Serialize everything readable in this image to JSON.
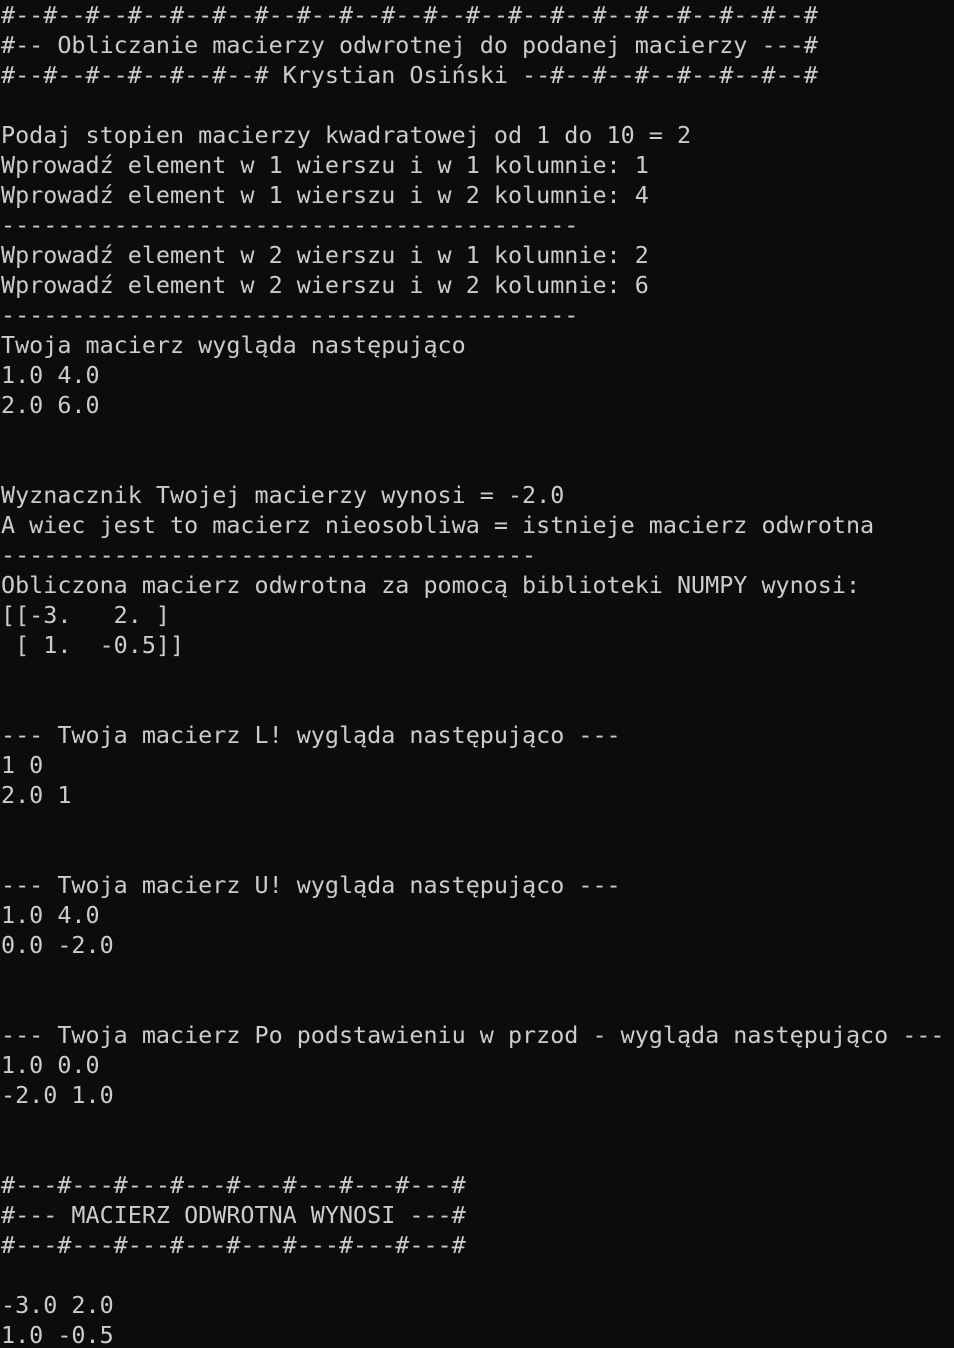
{
  "terminal": {
    "foreground": "#cccccc",
    "background": "#0c0c0c",
    "lines": [
      "#--#--#--#--#--#--#--#--#--#--#--#--#--#--#--#--#--#--#--#",
      "#-- Obliczanie macierzy odwrotnej do podanej macierzy ---#",
      "#--#--#--#--#--#--# Krystian Osiński --#--#--#--#--#--#--#",
      "",
      "Podaj stopien macierzy kwadratowej od 1 do 10 = 2",
      "Wprowadź element w 1 wierszu i w 1 kolumnie: 1",
      "Wprowadź element w 1 wierszu i w 2 kolumnie: 4",
      "-----------------------------------------",
      "Wprowadź element w 2 wierszu i w 1 kolumnie: 2",
      "Wprowadź element w 2 wierszu i w 2 kolumnie: 6",
      "-----------------------------------------",
      "Twoja macierz wygląda następująco",
      "1.0 4.0",
      "2.0 6.0",
      "",
      "",
      "Wyznacznik Twojej macierzy wynosi = -2.0",
      "A wiec jest to macierz nieosobliwa = istnieje macierz odwrotna",
      "--------------------------------------",
      "Obliczona macierz odwrotna za pomocą biblioteki NUMPY wynosi:",
      "[[-3.   2. ]",
      " [ 1.  -0.5]]",
      "",
      "",
      "--- Twoja macierz L! wygląda następująco ---",
      "1 0",
      "2.0 1",
      "",
      "",
      "--- Twoja macierz U! wygląda następująco ---",
      "1.0 4.0",
      "0.0 -2.0",
      "",
      "",
      "--- Twoja macierz Po podstawieniu w przod - wygląda następująco ---",
      "1.0 0.0",
      "-2.0 1.0",
      "",
      "",
      "#---#---#---#---#---#---#---#---#",
      "#--- MACIERZ ODWROTNA WYNOSI ---#",
      "#---#---#---#---#---#---#---#---#",
      "",
      "-3.0 2.0",
      "1.0 -0.5"
    ]
  }
}
